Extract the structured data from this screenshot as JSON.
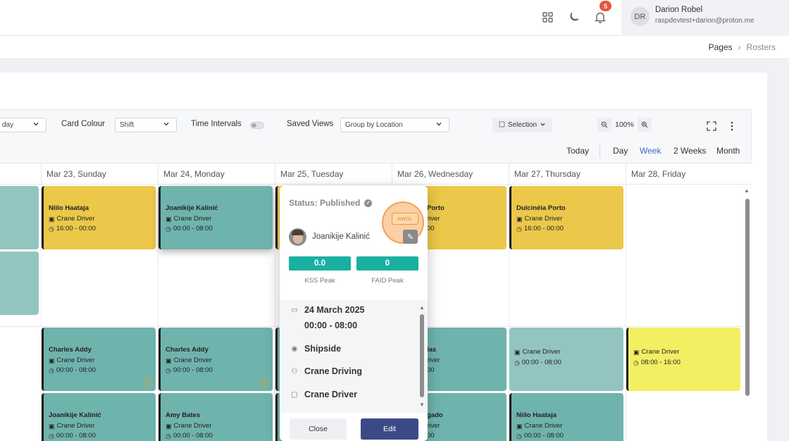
{
  "topbar": {
    "apps_icon": "grid-icon",
    "theme_icon": "moon-icon",
    "bell_icon": "bell-icon",
    "notification_count": "5",
    "user_initials": "DR",
    "user_name": "Darion Robel",
    "user_email": "raspdevtest+darion@proton.me"
  },
  "breadcrumb": {
    "parent": "Pages",
    "separator": "›",
    "current": "Rosters"
  },
  "toolbar": {
    "first_select_value": "day",
    "card_colour_label": "Card Colour",
    "card_colour_value": "Shift",
    "time_intervals_label": "Time Intervals",
    "saved_views_label": "Saved Views",
    "saved_views_value": "Group by Location",
    "selection_label": "Selection",
    "zoom_level": "100%",
    "views": {
      "today": "Today",
      "day": "Day",
      "week": "Week",
      "two_weeks": "2 Weeks",
      "month": "Month"
    },
    "active_view_color": "#3a6fc4"
  },
  "days": [
    "Mar 23, Sunday",
    "Mar 24, Monday",
    "Mar 25, Tuesday",
    "Mar 26, Wednesday",
    "Mar 27, Thursday",
    "Mar 28, Friday"
  ],
  "shifts": {
    "sun_1": {
      "name": "Niilo Haataja",
      "role": "Crane Driver",
      "time": "16:00 - 00:00"
    },
    "mon_1": {
      "name": "Joanikije Kalinić",
      "role": "Crane Driver",
      "time": "00:00 - 08:00"
    },
    "wed_1": {
      "name": "Porto",
      "role": "river",
      "time": "00"
    },
    "thu_1": {
      "name": "Dulcinéia Porto",
      "role": "Crane Driver",
      "time": "16:00 - 00:00"
    },
    "sun_2": {
      "name": "Charles Addy",
      "role": "Crane Driver",
      "time": "00:00 - 08:00"
    },
    "mon_2": {
      "name": "Charles Addy",
      "role": "Crane Driver",
      "time": "00:00 - 08:00"
    },
    "wed_2": {
      "name": "las",
      "role": "river",
      "time": "00"
    },
    "thu_2": {
      "role": "Crane Driver",
      "time": "00:00 - 08:00"
    },
    "fri_2": {
      "role": "Crane Driver",
      "time": "08:00 - 16:00"
    },
    "sun_3": {
      "name": "Joanikije Kalinić",
      "role": "Crane Driver",
      "time": "00:00 - 08:00"
    },
    "mon_3": {
      "name": "Amy Bates",
      "role": "Crane Driver",
      "time": "00:00 - 08:00"
    },
    "wed_3": {
      "name": "gado",
      "role": "river",
      "time": "00"
    },
    "thu_3": {
      "name": "Niilo Haataja",
      "role": "Crane Driver",
      "time": "00:00 - 08:00"
    }
  },
  "popup": {
    "status": "Status: Published",
    "awol": "AWOL",
    "employee": "Joanikije Kalinić",
    "kss_value": "0.0",
    "kss_label": "KSS Peak",
    "faid_value": "0",
    "faid_label": "FAID Peak",
    "date": "24 March 2025",
    "time": "00:00 - 08:00",
    "location": "Shipside",
    "activity": "Crane Driving",
    "role": "Crane Driver",
    "close_label": "Close",
    "edit_label": "Edit",
    "kpi_color": "#19b09f",
    "edit_button_color": "#3b4a87"
  },
  "colors": {
    "yellow_card": "#ebc84a",
    "teal_card": "#6fb3ad",
    "light_teal_card": "#92c5c0",
    "lime_card": "#f3ef63",
    "awol_highlight": "#f6aa5a"
  }
}
